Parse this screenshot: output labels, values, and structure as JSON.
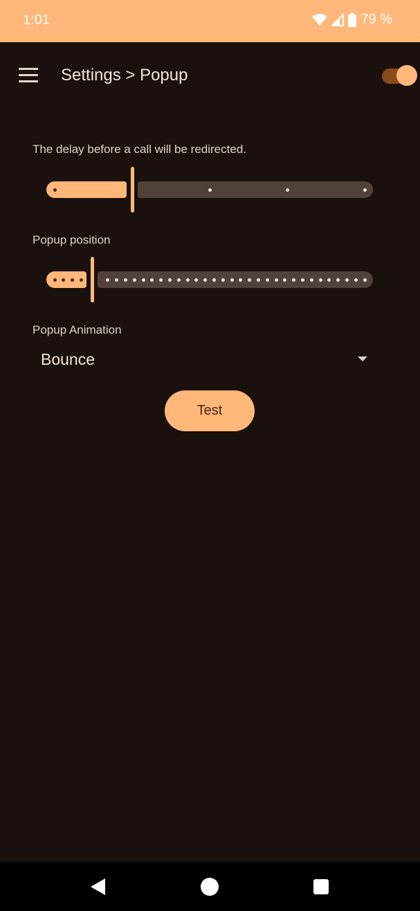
{
  "status_bar": {
    "time": "1:01",
    "battery": "79 %",
    "icons": [
      "wifi-icon",
      "cell-signal-icon",
      "battery-icon"
    ]
  },
  "app_bar": {
    "title": "Settings > Popup",
    "menu_icon": "hamburger-menu-icon",
    "toggle_on": true
  },
  "delay_setting": {
    "label": "The delay before a call will be redirected.",
    "level": 0.25,
    "steps": 5
  },
  "position_setting": {
    "label": "Popup position",
    "level": 0.12,
    "steps": 36
  },
  "animation_setting": {
    "label": "Popup Animation",
    "selected": "Bounce"
  },
  "test_button": {
    "label": "Test"
  },
  "colors": {
    "accent": "#ffb77a",
    "background": "#1a110e",
    "track_inactive": "#52413a"
  },
  "nav_bar": {
    "icons": [
      "back-icon",
      "home-icon",
      "recents-icon"
    ]
  }
}
